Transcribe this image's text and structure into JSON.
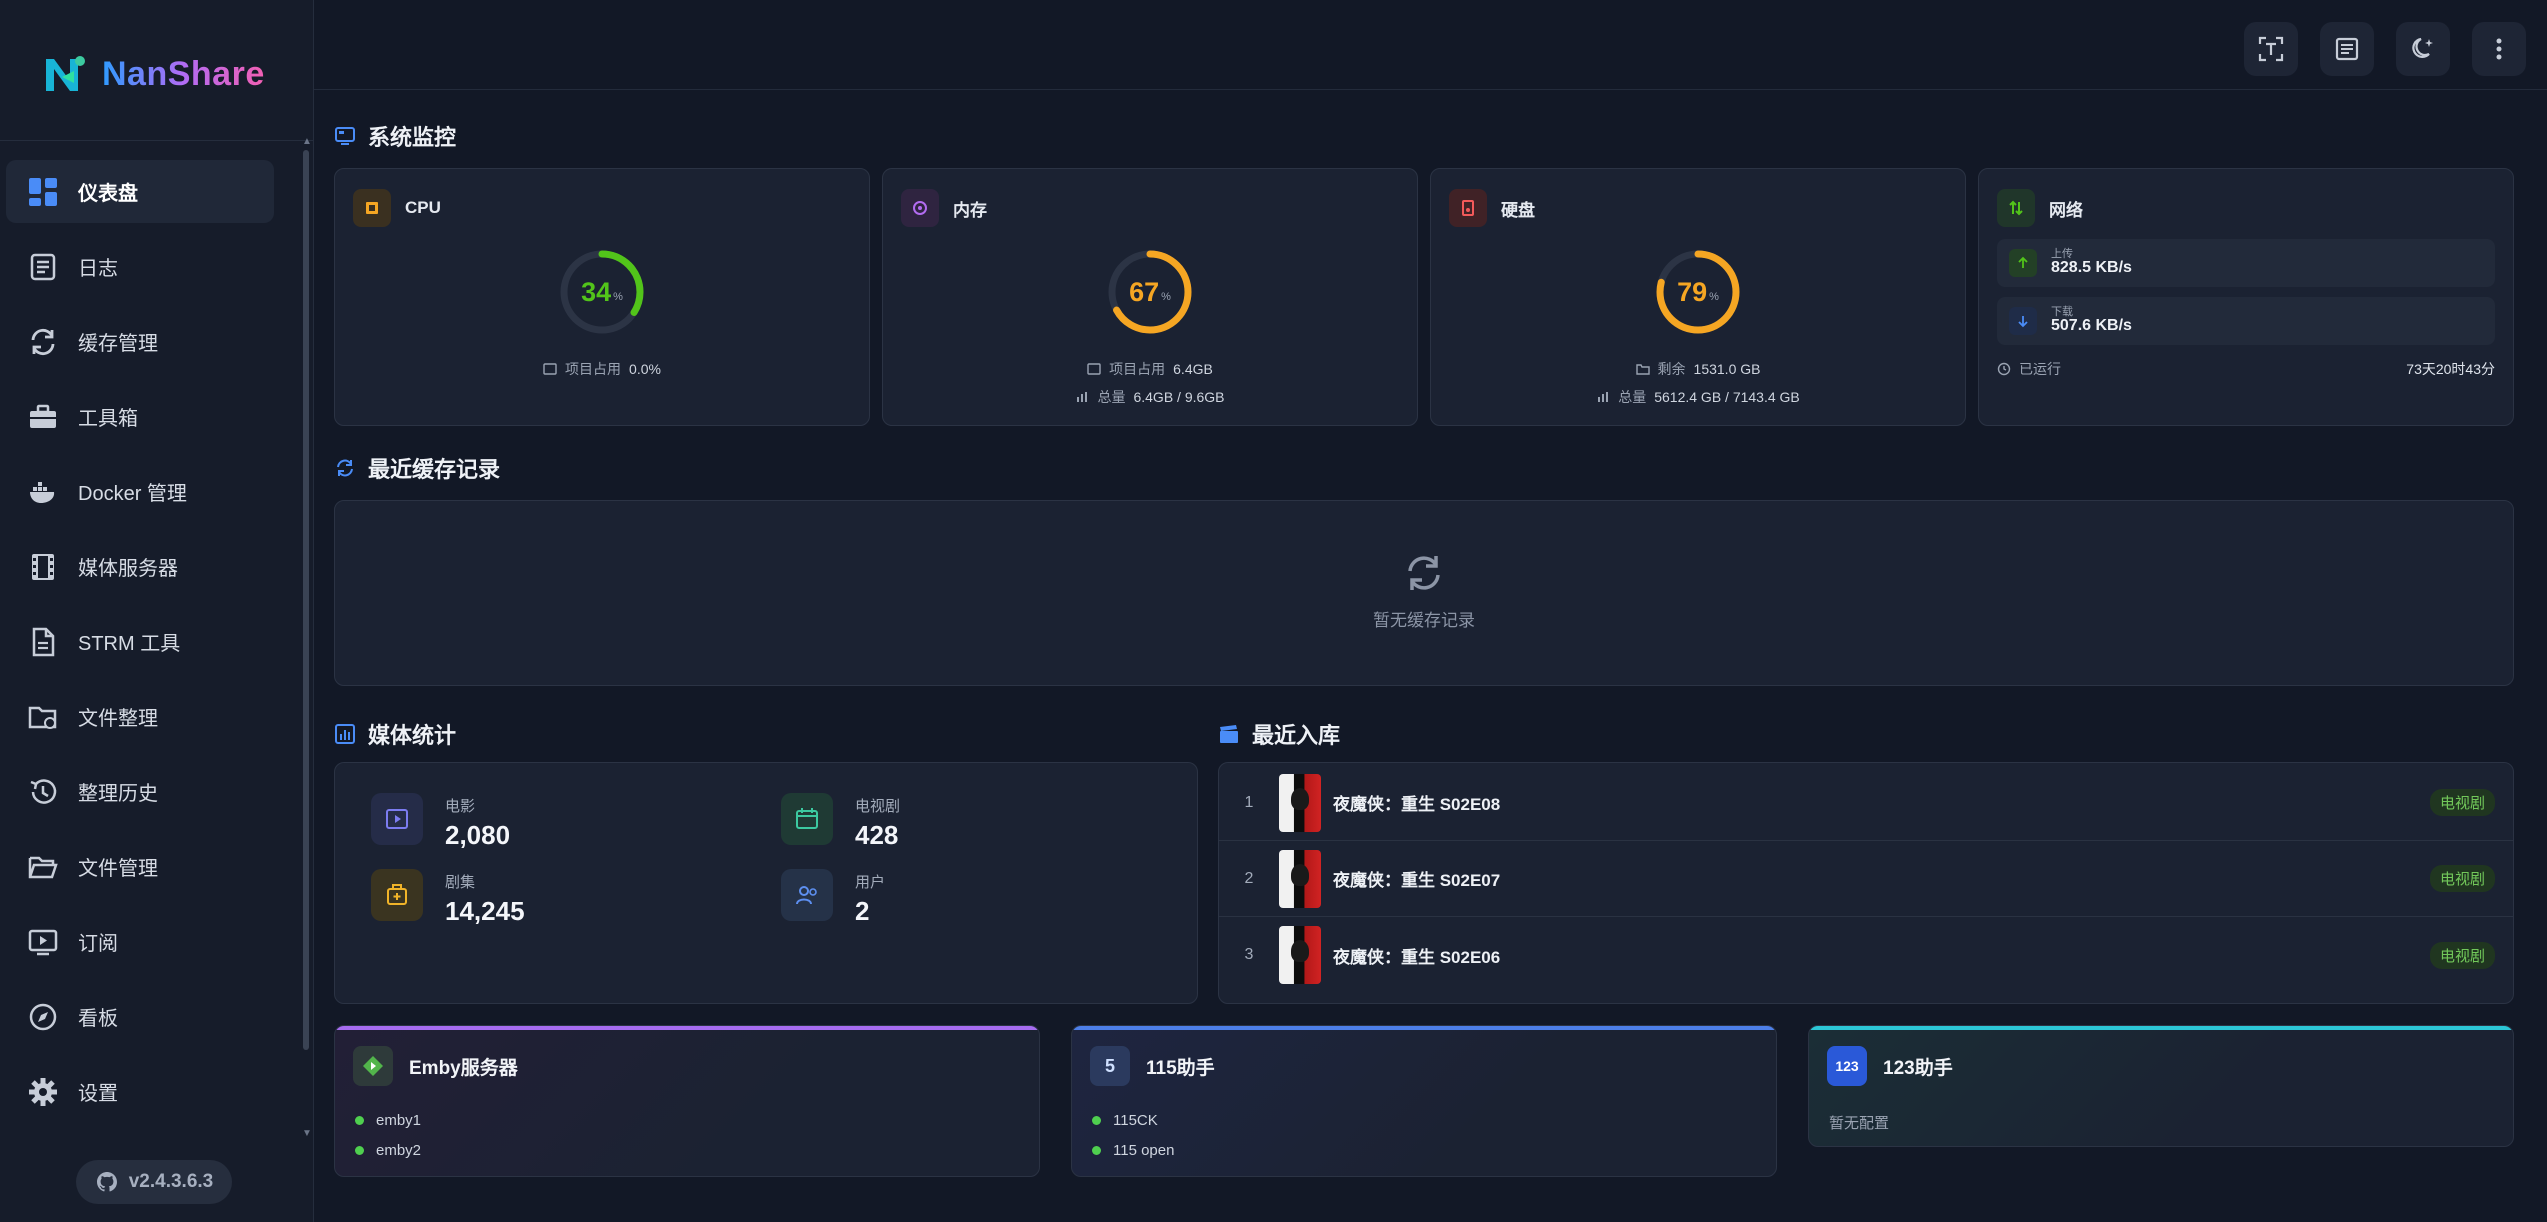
{
  "app": {
    "name": "NanShare",
    "version": "v2.4.3.6.3"
  },
  "sidebar": {
    "items": [
      {
        "label": "仪表盘",
        "icon": "dashboard-icon",
        "active": true
      },
      {
        "label": "日志",
        "icon": "log-icon"
      },
      {
        "label": "缓存管理",
        "icon": "sync-icon"
      },
      {
        "label": "工具箱",
        "icon": "toolbox-icon"
      },
      {
        "label": "Docker 管理",
        "icon": "docker-icon"
      },
      {
        "label": "媒体服务器",
        "icon": "film-icon"
      },
      {
        "label": "STRM 工具",
        "icon": "file-icon"
      },
      {
        "label": "文件整理",
        "icon": "folder-sync-icon"
      },
      {
        "label": "整理历史",
        "icon": "history-icon"
      },
      {
        "label": "文件管理",
        "icon": "folder-open-icon"
      },
      {
        "label": "订阅",
        "icon": "subscribe-icon"
      },
      {
        "label": "看板",
        "icon": "compass-icon"
      },
      {
        "label": "设置",
        "icon": "gear-icon"
      }
    ]
  },
  "monitor": {
    "title": "系统监控",
    "cpu": {
      "label": "CPU",
      "percent": 34,
      "unit": "%",
      "line1_label": "项目占用",
      "line1_value": "0.0%"
    },
    "memory": {
      "label": "内存",
      "percent": 67,
      "unit": "%",
      "line1_label": "项目占用",
      "line1_value": "6.4GB",
      "line2_label": "总量",
      "line2_value": "6.4GB / 9.6GB"
    },
    "disk": {
      "label": "硬盘",
      "percent": 79,
      "unit": "%",
      "line1_label": "剩余",
      "line1_value": "1531.0 GB",
      "line2_label": "总量",
      "line2_value": "5612.4 GB / 7143.4 GB"
    },
    "network": {
      "label": "网络",
      "upload_label": "上传",
      "upload_value": "828.5 KB/s",
      "download_label": "下载",
      "download_value": "507.6 KB/s",
      "uptime_label": "已运行",
      "uptime_value": "73天20时43分"
    }
  },
  "cache": {
    "title": "最近缓存记录",
    "empty_text": "暂无缓存记录"
  },
  "media_stats": {
    "title": "媒体统计",
    "movies": {
      "label": "电影",
      "value": "2,080"
    },
    "tv": {
      "label": "电视剧",
      "value": "428"
    },
    "episodes": {
      "label": "剧集",
      "value": "14,245"
    },
    "users": {
      "label": "用户",
      "value": "2"
    }
  },
  "recent": {
    "title": "最近入库",
    "items": [
      {
        "index": "1",
        "title": "夜魔侠：重生 S02E08",
        "tag": "电视剧"
      },
      {
        "index": "2",
        "title": "夜魔侠：重生 S02E07",
        "tag": "电视剧"
      },
      {
        "index": "3",
        "title": "夜魔侠：重生 S02E06",
        "tag": "电视剧"
      }
    ]
  },
  "services": {
    "emby": {
      "title": "Emby服务器",
      "items": [
        "emby1",
        "emby2"
      ],
      "accent": "#a66cf0"
    },
    "s115": {
      "title": "115助手",
      "icon_text": "5",
      "items": [
        "115CK",
        "115 open"
      ],
      "accent": "#4d7fe8"
    },
    "s123": {
      "title": "123助手",
      "icon_text": "123",
      "empty_text": "暂无配置",
      "accent": "#2cc6d6"
    }
  },
  "colors": {
    "cpu": "#52c41a",
    "memory": "#f5a623",
    "disk": "#f5a623",
    "bg": "#121826"
  }
}
